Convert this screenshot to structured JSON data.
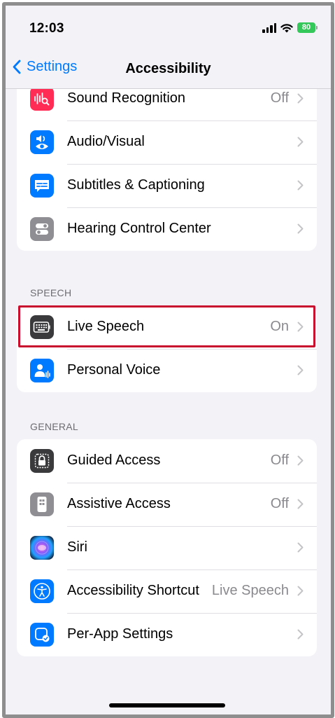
{
  "status_bar": {
    "time": "12:03",
    "battery_level": "80"
  },
  "nav": {
    "back_label": "Settings",
    "title": "Accessibility"
  },
  "hearing_group": {
    "rows": [
      {
        "label": "Sound Recognition",
        "value": "Off",
        "icon": "sound-recognition-icon",
        "color": "#ff2d55"
      },
      {
        "label": "Audio/Visual",
        "value": "",
        "icon": "audio-visual-icon",
        "color": "#007aff"
      },
      {
        "label": "Subtitles & Captioning",
        "value": "",
        "icon": "subtitles-icon",
        "color": "#007aff"
      },
      {
        "label": "Hearing Control Center",
        "value": "",
        "icon": "hearing-control-center-icon",
        "color": "#8e8e93"
      }
    ]
  },
  "speech_section": {
    "header": "SPEECH",
    "rows": [
      {
        "label": "Live Speech",
        "value": "On",
        "icon": "keyboard-icon",
        "color": "#3a3a3c"
      },
      {
        "label": "Personal Voice",
        "value": "",
        "icon": "personal-voice-icon",
        "color": "#007aff"
      }
    ]
  },
  "general_section": {
    "header": "GENERAL",
    "rows": [
      {
        "label": "Guided Access",
        "value": "Off",
        "icon": "lock-icon",
        "color": "#3a3a3c"
      },
      {
        "label": "Assistive Access",
        "value": "Off",
        "icon": "assistive-access-icon",
        "color": "#8e8e93"
      },
      {
        "label": "Siri",
        "value": "",
        "icon": "siri-icon",
        "color": "#1c1c1e"
      },
      {
        "label": "Accessibility Shortcut",
        "value": "Live Speech",
        "icon": "accessibility-icon",
        "color": "#007aff"
      },
      {
        "label": "Per-App Settings",
        "value": "",
        "icon": "per-app-settings-icon",
        "color": "#007aff"
      }
    ]
  },
  "colors": {
    "accent": "#007aff",
    "highlight": "#c8102e",
    "battery": "#34c759"
  }
}
